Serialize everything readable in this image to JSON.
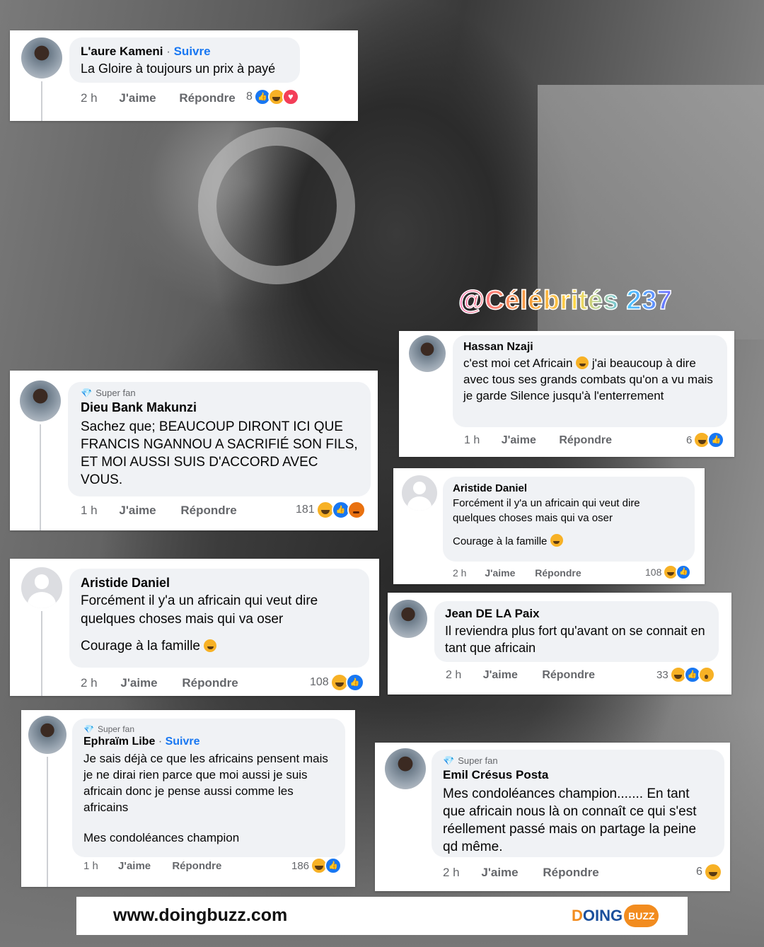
{
  "watermark": "@Célébrités 237",
  "footer": {
    "url": "www.doingbuzz.com",
    "logo_doing": "OING",
    "logo_d": "D",
    "logo_buzz": "BUZZ"
  },
  "comments": [
    {
      "name": "L'aure Kameni",
      "follow": "Suivre",
      "text": "La Gloire à toujours un prix à payé",
      "time": "2 h",
      "like": "J'aime",
      "reply": "Répondre",
      "count": "8",
      "reactions": [
        "like",
        "haha",
        "love"
      ]
    },
    {
      "name": "Hassan Nzaji",
      "text_a": "c'est moi cet Africain",
      "text_b": "j'ai beaucoup à dire avec tous ses grands combats qu'on a vu mais je garde Silence jusqu'à l'enterrement",
      "time": "1 h",
      "like": "J'aime",
      "reply": "Répondre",
      "count": "6",
      "reactions": [
        "haha",
        "like"
      ]
    },
    {
      "badge": "Super fan",
      "name": "Dieu Bank Makunzi",
      "text": "Sachez que; BEAUCOUP DIRONT ICI QUE FRANCIS NGANNOU A SACRIFIÉ SON FILS, ET   MOI AUSSI SUIS D'ACCORD AVEC VOUS.",
      "time": "1 h",
      "like": "J'aime",
      "reply": "Répondre",
      "count": "181",
      "reactions": [
        "haha",
        "like",
        "angry"
      ]
    },
    {
      "name": "Aristide Daniel",
      "text": "Forcément il y'a un africain qui veut dire quelques choses mais qui va oser",
      "text2": "Courage à la famille",
      "time": "2 h",
      "like": "J'aime",
      "reply": "Répondre",
      "count": "108",
      "reactions": [
        "haha",
        "like"
      ]
    },
    {
      "name": "Aristide Daniel",
      "text": "Forcément il y'a un africain qui veut dire quelques choses mais qui va oser",
      "text2": "Courage à la famille",
      "time": "2 h",
      "like": "J'aime",
      "reply": "Répondre",
      "count": "108",
      "reactions": [
        "haha",
        "like"
      ]
    },
    {
      "name": "Jean DE LA Paix",
      "text": "Il reviendra plus fort qu'avant on se connait en tant que africain",
      "time": "2 h",
      "like": "J'aime",
      "reply": "Répondre",
      "count": "33",
      "reactions": [
        "haha",
        "like",
        "wow"
      ]
    },
    {
      "badge": "Super fan",
      "name": "Ephraïm Libe",
      "follow": "Suivre",
      "text": "Je sais déjà ce que les africains pensent mais je ne dirai rien parce que moi aussi je suis africain donc je pense aussi comme les africains",
      "text2": "Mes condoléances champion",
      "time": "1 h",
      "like": "J'aime",
      "reply": "Répondre",
      "count": "186",
      "reactions": [
        "haha",
        "like"
      ]
    },
    {
      "badge": "Super fan",
      "name": "Emil Crésus Posta",
      "text": "Mes condoléances champion....... En tant que africain nous là on connaît ce qui s'est réellement passé mais on partage la peine qd même.",
      "time": "2 h",
      "like": "J'aime",
      "reply": "Répondre",
      "count": "6",
      "reactions": [
        "haha"
      ]
    }
  ]
}
